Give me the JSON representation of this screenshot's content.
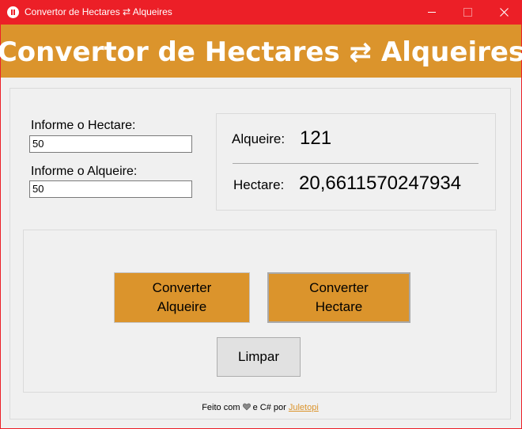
{
  "window": {
    "title": "Convertor de Hectares ⇄ Alqueires",
    "accent_color": "#ec1f27"
  },
  "header": {
    "title": "Convertor de Hectares ⇄ Alqueires",
    "background_color": "#db942c"
  },
  "inputs": {
    "hectare_label": "Informe o Hectare:",
    "hectare_value": "50",
    "alqueire_label": "Informe o Alqueire:",
    "alqueire_value": "50"
  },
  "results": {
    "alqueire_label": "Alqueire:",
    "alqueire_value": "121",
    "hectare_label": "Hectare:",
    "hectare_value": "20,6611570247934"
  },
  "buttons": {
    "convert_alqueire_line1": "Converter",
    "convert_alqueire_line2": "Alqueire",
    "convert_hectare_line1": "Converter",
    "convert_hectare_line2": "Hectare",
    "clear": "Limpar"
  },
  "footer": {
    "prefix": "Feito com",
    "icon": "heart-icon",
    "middle": "e C# por",
    "author": "Juletopi"
  }
}
